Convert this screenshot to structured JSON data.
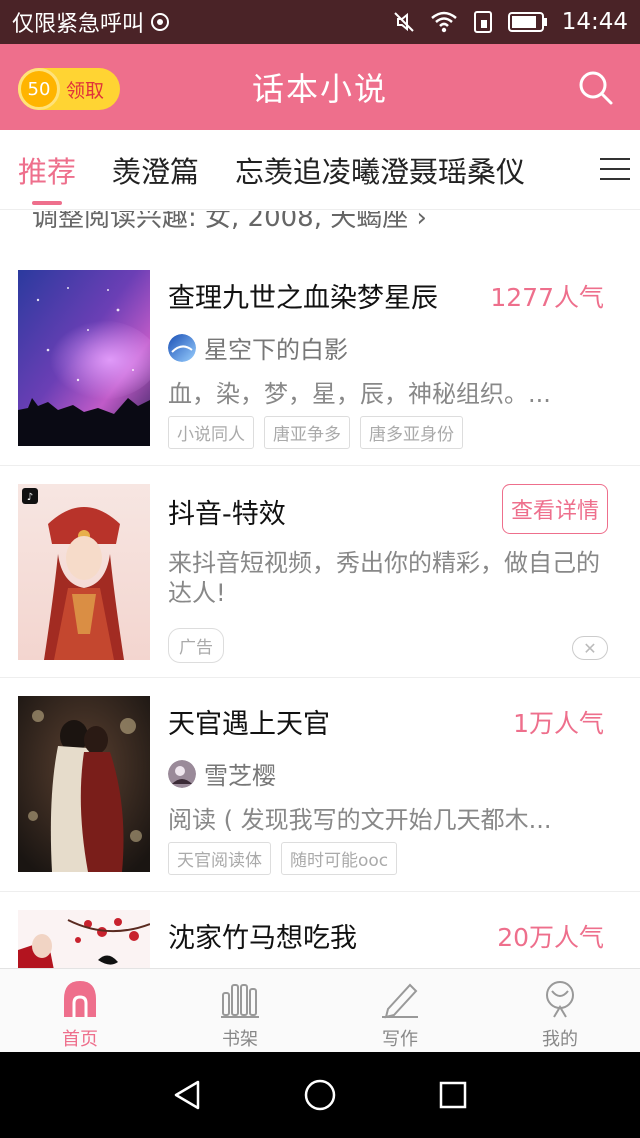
{
  "status_bar": {
    "carrier": "仅限紧急呼叫",
    "time": "14:44"
  },
  "header": {
    "title": "话本小说",
    "coin_value": "50",
    "coin_label": "领取"
  },
  "tabs": [
    "推荐",
    "羡澄篇",
    "忘羡追凌曦澄聂瑶桑仪"
  ],
  "interest": "调整阅读兴趣: 女, 2008, 天蝎座",
  "books": [
    {
      "title": "查理九世之血染梦星辰",
      "popularity": "1277人气",
      "author": "星空下的白影",
      "desc": "血，染，梦，星，辰，神秘组织。...",
      "tags": [
        "小说同人",
        "唐亚争多",
        "唐多亚身份"
      ]
    },
    {
      "title": "天官遇上天官",
      "popularity": "1万人气",
      "author": "雪芝樱",
      "desc": "阅读 ( 发现我写的文开始几天都木...",
      "tags": [
        "天官阅读体",
        "随时可能ooc"
      ]
    },
    {
      "title": "沈家竹马想吃我",
      "popularity": "20万人气"
    }
  ],
  "ad": {
    "title": "抖音-特效",
    "button": "查看详情",
    "desc": "来抖音短视频，秀出你的精彩，做自己的达人!",
    "tag": "广告"
  },
  "bottom_nav": [
    "首页",
    "书架",
    "写作",
    "我的"
  ],
  "colors": {
    "accent": "#ee6f8c",
    "status_bar": "#4a2327"
  },
  "icons": [
    "mute-icon",
    "wifi-icon",
    "sim-icon",
    "battery-icon",
    "search-icon",
    "menu-icon",
    "home-icon",
    "bookshelf-icon",
    "pen-icon",
    "profile-icon",
    "back-icon",
    "circle-home-icon",
    "recent-apps-icon"
  ]
}
